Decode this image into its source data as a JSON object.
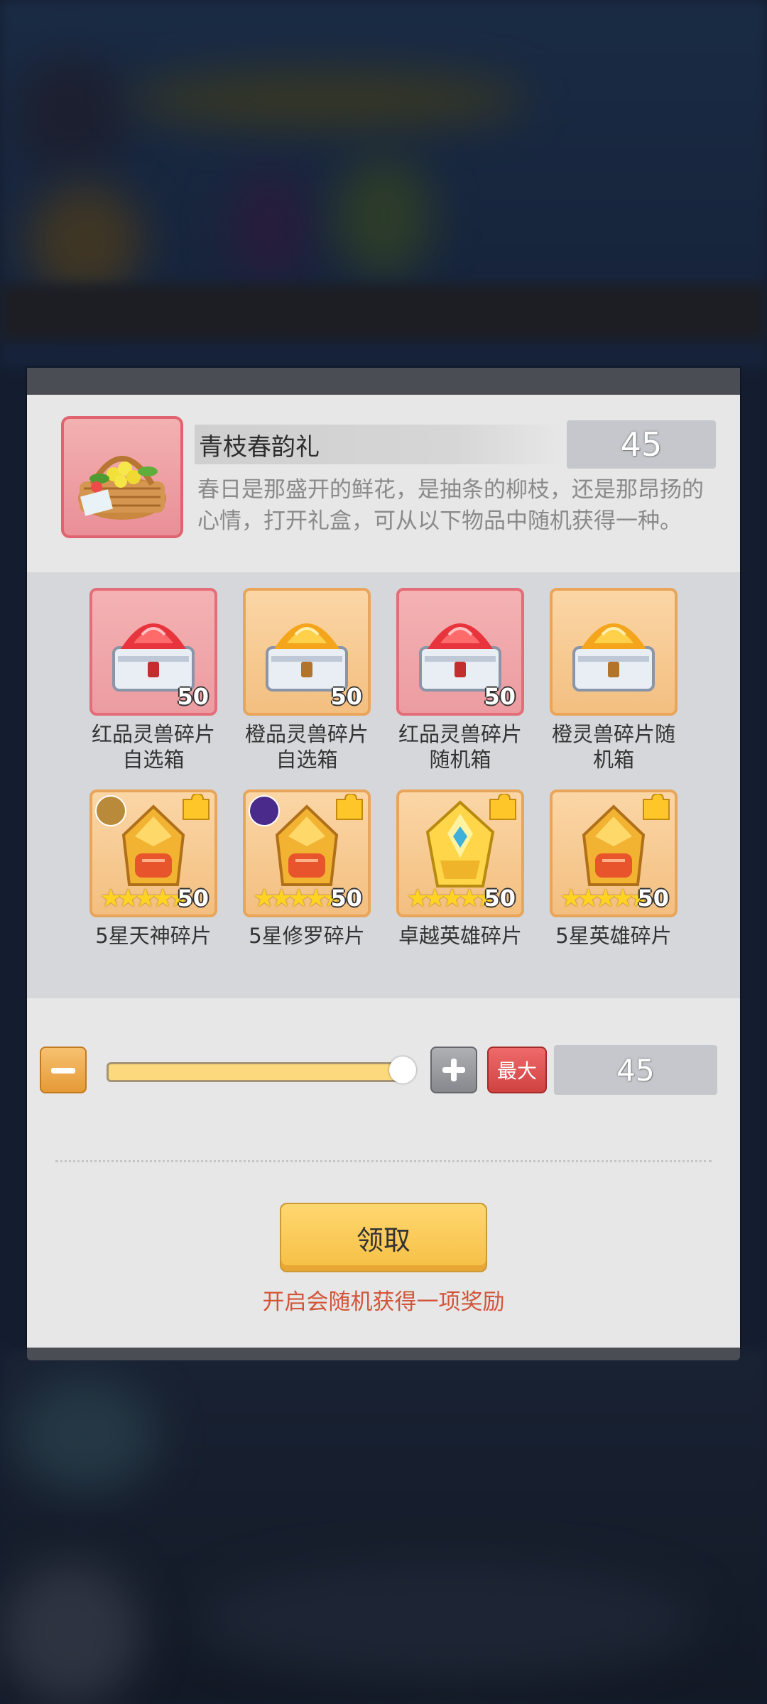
{
  "gift": {
    "name": "青枝春韵礼",
    "count": "45",
    "description": "春日是那盛开的鲜花，是抽条的柳枝，还是那昂扬的心情，打开礼盒，可从以下物品中随机获得一种。"
  },
  "items": [
    {
      "label": "红品灵兽碎片自选箱",
      "qty": "50",
      "tile": "red",
      "icon": "red-gem-chest-icon"
    },
    {
      "label": "橙品灵兽碎片自选箱",
      "qty": "50",
      "tile": "orange",
      "icon": "orange-gem-chest-icon"
    },
    {
      "label": "红品灵兽碎片随机箱",
      "qty": "50",
      "tile": "red",
      "icon": "red-gem-chest-icon"
    },
    {
      "label": "橙灵兽碎片随机箱",
      "qty": "",
      "tile": "orange",
      "icon": "orange-gem-chest-icon"
    },
    {
      "label": "5星天神碎片",
      "qty": "50",
      "tile": "orange",
      "icon": "helmet-shard-icon",
      "stars": "★★★★★"
    },
    {
      "label": "5星修罗碎片",
      "qty": "50",
      "tile": "orange",
      "icon": "helmet-shard-icon",
      "stars": "★★★★★"
    },
    {
      "label": "卓越英雄碎片",
      "qty": "50",
      "tile": "orange",
      "icon": "golden-helmet-shard-icon",
      "stars": "★★★★★"
    },
    {
      "label": "5星英雄碎片",
      "qty": "50",
      "tile": "orange",
      "icon": "helmet-shard-icon",
      "stars": "★★★★★"
    }
  ],
  "amount": {
    "max_label": "最大",
    "value": "45",
    "slider_fraction": 1.0
  },
  "claim": {
    "button_label": "领取",
    "hint": "开启会随机获得一项奖励"
  },
  "colors": {
    "accent_orange": "#f6bf43",
    "hint_red": "#d2553a",
    "max_red": "#d04242"
  }
}
